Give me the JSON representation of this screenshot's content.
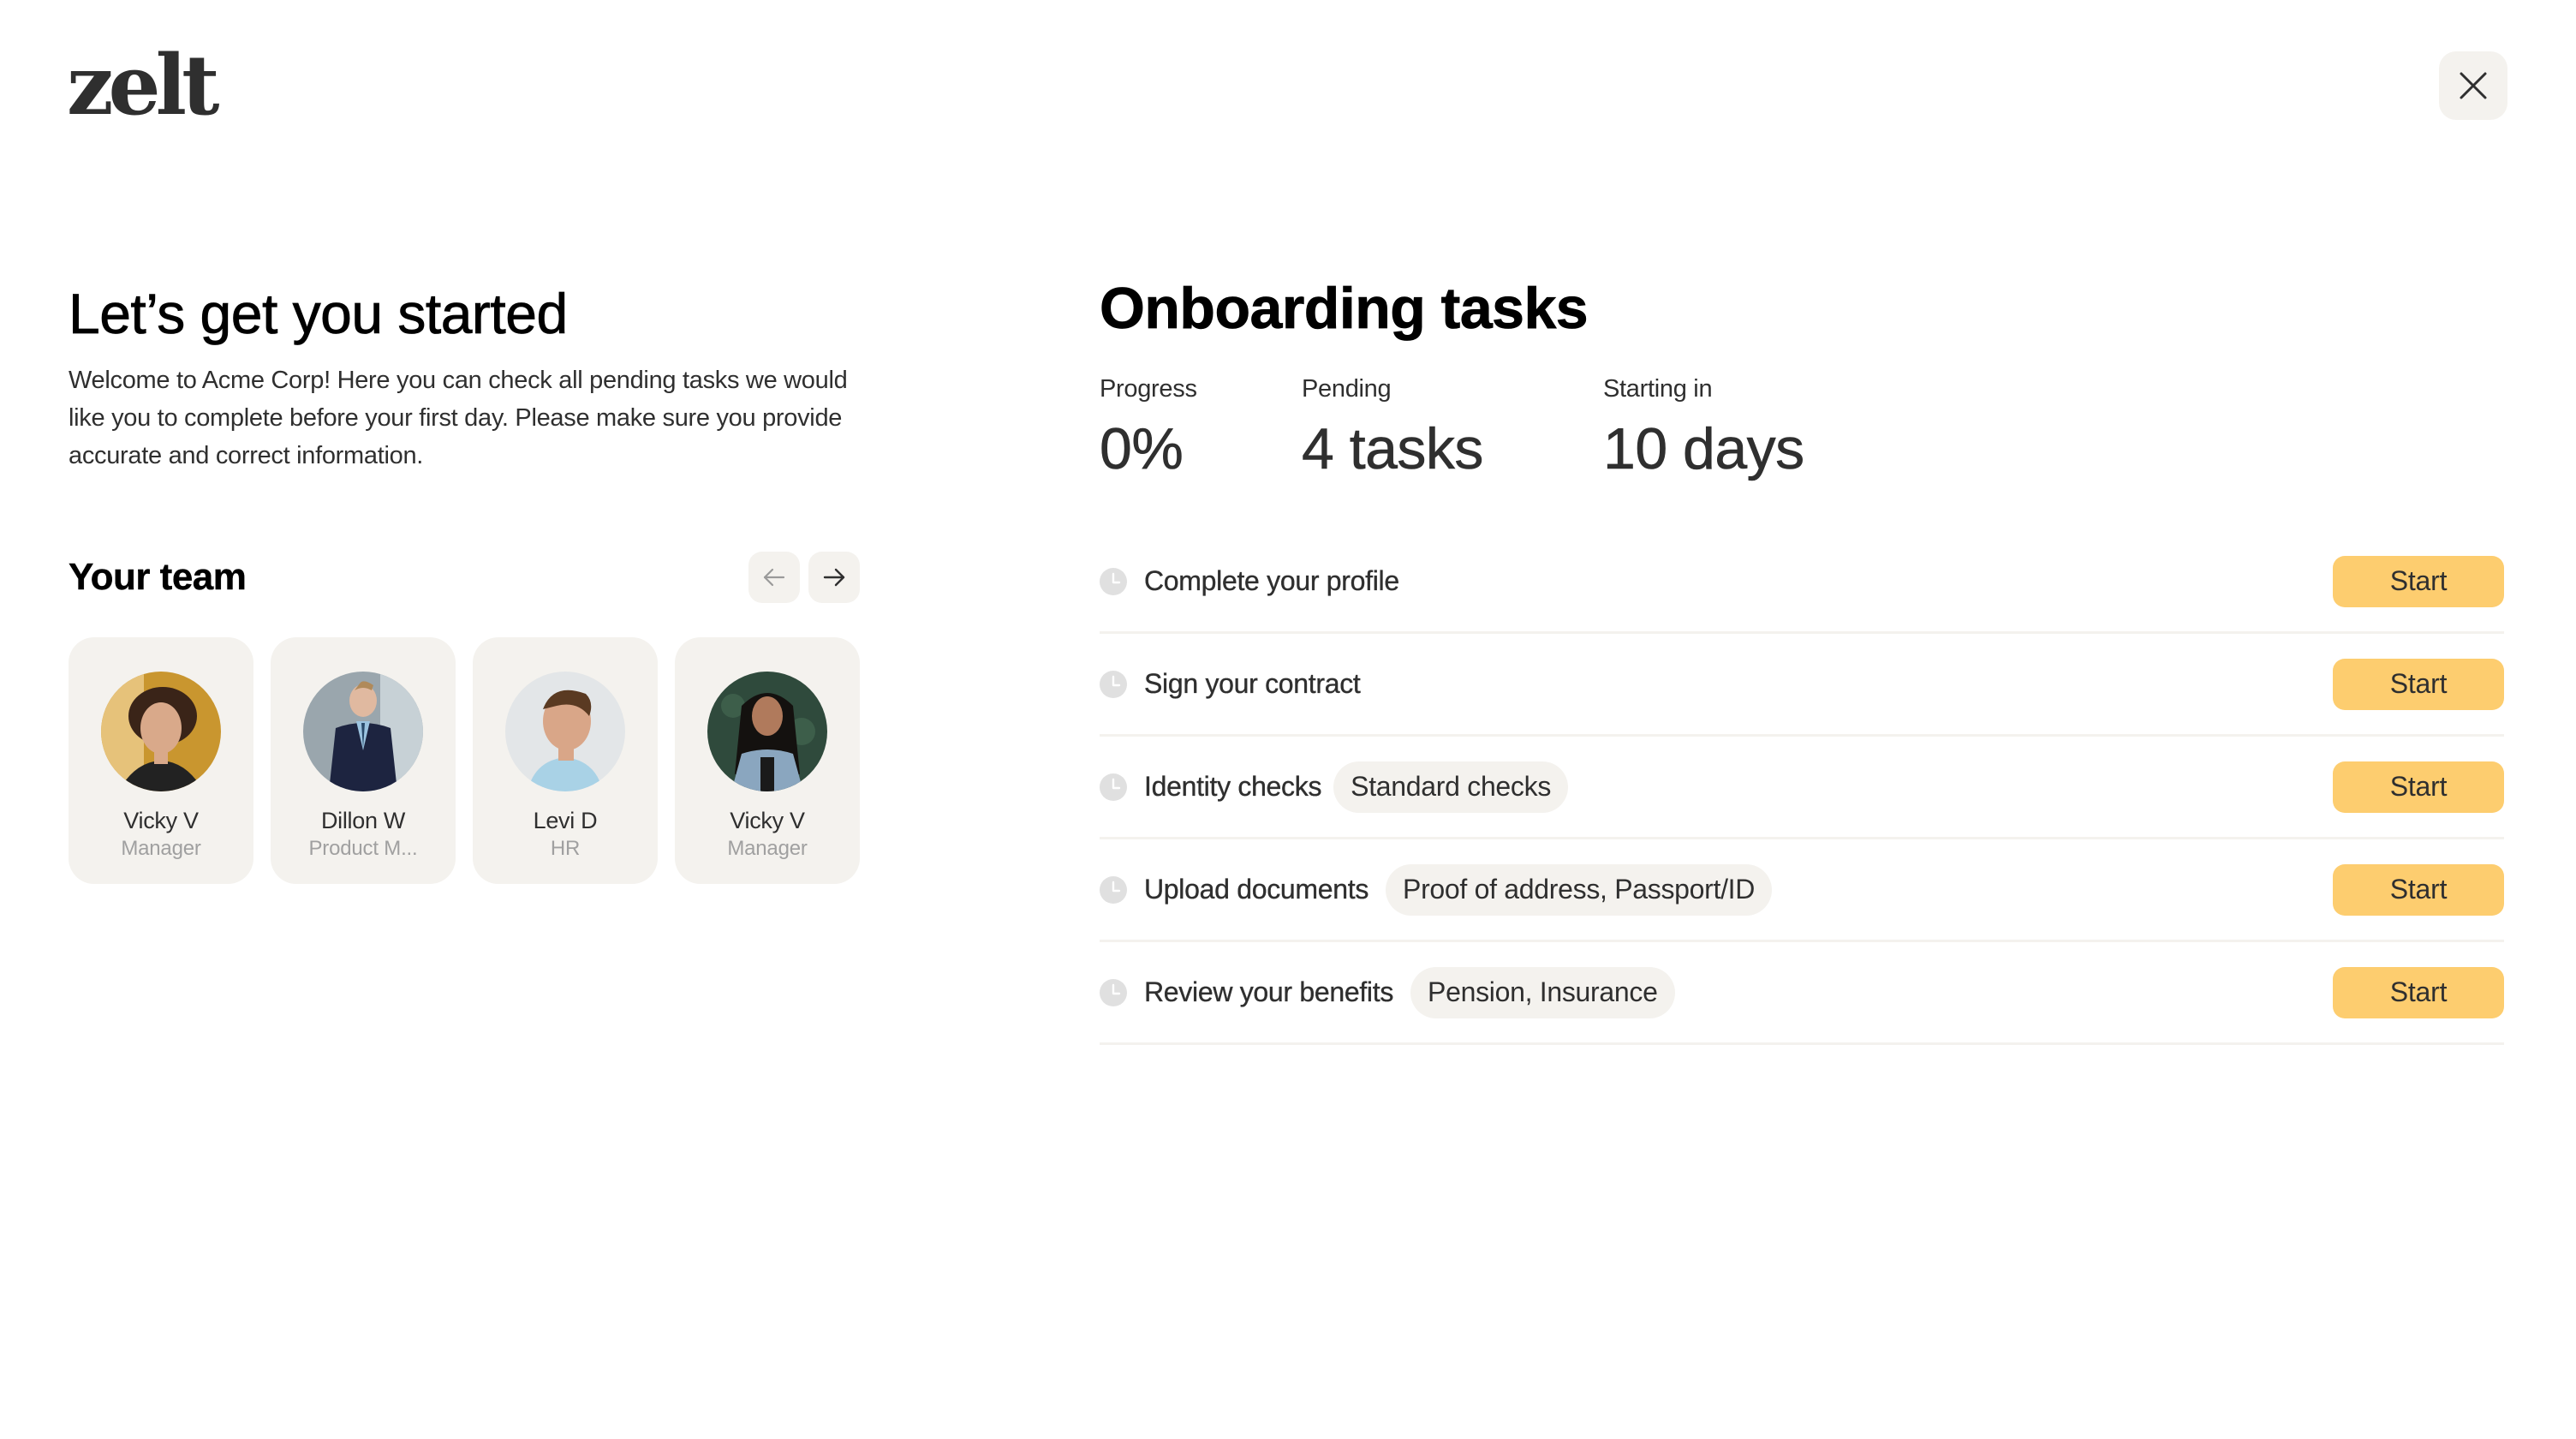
{
  "brand": {
    "logo_text": "zelt"
  },
  "header": {
    "close_icon": "close-icon"
  },
  "intro": {
    "title": "Let’s get you started",
    "description": "Welcome to Acme Corp! Here you can check all pending tasks we would like you to complete before your first day. Please make sure you provide accurate and correct information."
  },
  "team": {
    "title": "Your team",
    "prev_icon": "arrow-left-icon",
    "next_icon": "arrow-right-icon",
    "prev_disabled": true,
    "members": [
      {
        "name": "Vicky V",
        "role": "Manager"
      },
      {
        "name": "Dillon W",
        "role": "Product M..."
      },
      {
        "name": "Levi D",
        "role": "HR"
      },
      {
        "name": "Vicky V",
        "role": "Manager"
      }
    ]
  },
  "onboarding": {
    "title": "Onboarding tasks",
    "stats": [
      {
        "label": "Progress",
        "value": "0%"
      },
      {
        "label": "Pending",
        "value": "4 tasks"
      },
      {
        "label": "Starting in",
        "value": "10 days"
      }
    ],
    "progress_percent": 0,
    "tasks": [
      {
        "label": "Complete your profile",
        "chip": null,
        "status_icon": "clock-icon",
        "action": "Start"
      },
      {
        "label": "Sign your contract",
        "chip": null,
        "status_icon": "clock-icon",
        "action": "Start"
      },
      {
        "label": "Identity checks",
        "chip": "Standard checks",
        "status_icon": "clock-icon",
        "action": "Start"
      },
      {
        "label": "Upload documents",
        "chip": "Proof of address, Passport/ID",
        "status_icon": "clock-icon",
        "action": "Start"
      },
      {
        "label": "Review your benefits",
        "chip": "Pension, Insurance",
        "status_icon": "clock-icon",
        "action": "Start"
      }
    ]
  },
  "colors": {
    "accent": "#fdcd6f",
    "surface": "#f4f2ee",
    "text": "#2f2f2f",
    "muted": "#a0a0a0",
    "icon_pending": "#e0e0e0"
  }
}
